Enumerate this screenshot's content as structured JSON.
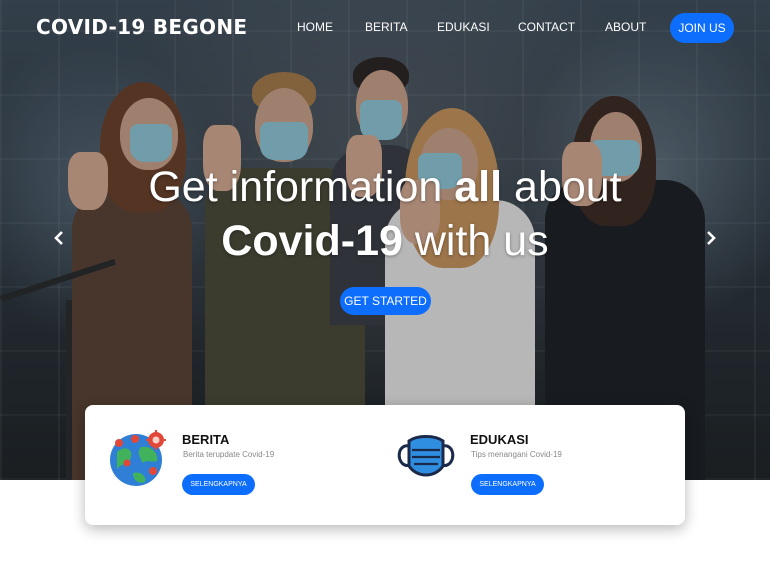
{
  "brand": {
    "name": "COVID-19 BEGONE"
  },
  "nav": {
    "items": [
      "HOME",
      "BERITA",
      "EDUKASI",
      "CONTACT",
      "ABOUT"
    ],
    "join_label": "JOIN US"
  },
  "hero": {
    "line1_pre": "Get information ",
    "line1_bold": "all",
    "line1_post": " about",
    "line2_bold": "Covid-19",
    "line2_post": " with us",
    "cta_label": "GET STARTED",
    "prev_icon": "chevron-left-icon",
    "next_icon": "chevron-right-icon"
  },
  "services": [
    {
      "title": "BERITA",
      "desc": "Berita terupdate Covid-19",
      "button": "SELENGKAPNYA",
      "icon": "globe-virus-icon"
    },
    {
      "title": "EDUKASI",
      "desc": "Tips menangani Covid-19",
      "button": "SELENGKAPNYA",
      "icon": "face-mask-icon"
    }
  ],
  "colors": {
    "accent": "#0d6efd",
    "card_bg": "#ffffff",
    "page_bg": "#ffffff"
  }
}
